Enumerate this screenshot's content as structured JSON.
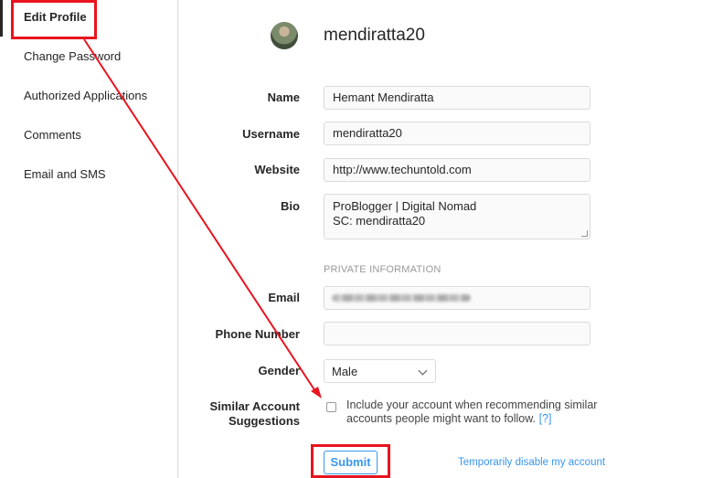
{
  "sidebar": {
    "items": [
      {
        "label": "Edit Profile",
        "active": true
      },
      {
        "label": "Change Password"
      },
      {
        "label": "Authorized Applications"
      },
      {
        "label": "Comments"
      },
      {
        "label": "Email and SMS"
      }
    ]
  },
  "profile": {
    "username_heading": "mendiratta20",
    "avatar_icon": "user-avatar"
  },
  "form": {
    "name": {
      "label": "Name",
      "value": "Hemant Mendiratta"
    },
    "username": {
      "label": "Username",
      "value": "mendiratta20"
    },
    "website": {
      "label": "Website",
      "value": "http://www.techuntold.com"
    },
    "bio": {
      "label": "Bio",
      "line1": "ProBlogger | Digital Nomad",
      "line2": "SC: mendiratta20"
    },
    "private_heading": "PRIVATE INFORMATION",
    "email": {
      "label": "Email"
    },
    "phone": {
      "label": "Phone Number",
      "value": ""
    },
    "gender": {
      "label": "Gender",
      "value": "Male"
    },
    "suggestions": {
      "label_line1": "Similar Account",
      "label_line2": "Suggestions",
      "text": "Include your account when recommending similar accounts people might want to follow.",
      "help": "[?]",
      "checked": false
    },
    "submit_label": "Submit",
    "disable_link": "Temporarily disable my account"
  },
  "annotation": {
    "color": "#e8141f"
  },
  "colors": {
    "accent": "#3897f0",
    "border": "#dbdbdb",
    "text": "#262626"
  }
}
